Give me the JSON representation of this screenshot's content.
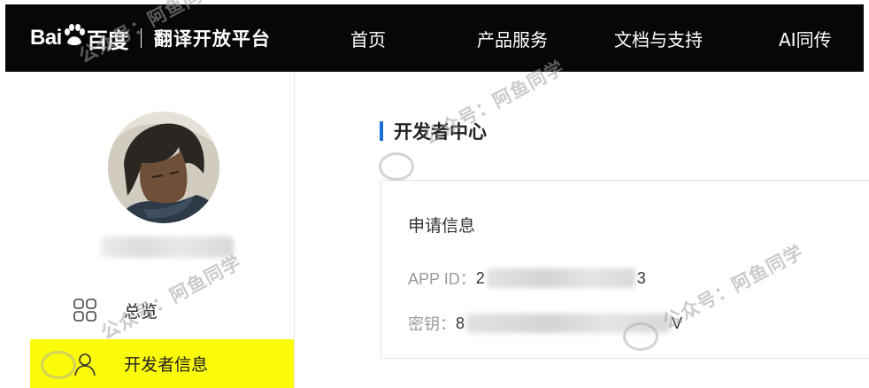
{
  "header": {
    "logo_left": "Bai",
    "logo_mid": "du",
    "logo_right": "百度",
    "platform_title": "翻译开放平台",
    "nav": [
      {
        "label": "首页"
      },
      {
        "label": "产品服务"
      },
      {
        "label": "文档与支持"
      },
      {
        "label": "AI同传"
      }
    ]
  },
  "sidebar": {
    "menu": [
      {
        "label": "总览",
        "icon": "grid-icon"
      },
      {
        "label": "开发者信息",
        "icon": "user-icon",
        "active": true
      }
    ],
    "active_color": "#fbfb0a"
  },
  "main": {
    "section_title": "开发者中心",
    "card": {
      "heading": "申请信息",
      "app_id": {
        "label": "APP ID：",
        "prefix": "2",
        "suffix": "3"
      },
      "secret": {
        "label": "密钥：",
        "prefix": "8",
        "suffix": "V"
      }
    },
    "accent_color": "#1a6fd6"
  },
  "watermark": {
    "text": "公众号：阿鱼同学"
  }
}
